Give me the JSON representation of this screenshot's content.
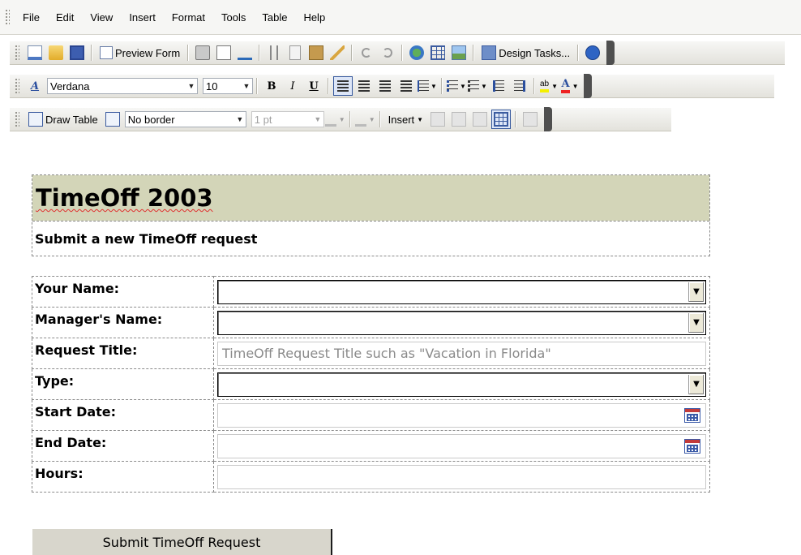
{
  "menubar": {
    "items": [
      "File",
      "Edit",
      "View",
      "Insert",
      "Format",
      "Tools",
      "Table",
      "Help"
    ]
  },
  "standard_toolbar": {
    "preview_form_label": "Preview Form",
    "design_tasks_label": "Design Tasks..."
  },
  "formatting_toolbar": {
    "font_name": "Verdana",
    "font_size": "10",
    "bold_label": "B",
    "italic_label": "I",
    "underline_label": "U",
    "highlight_label": "ab",
    "font_color_label": "A"
  },
  "table_toolbar": {
    "draw_table_label": "Draw Table",
    "border_style": "No border",
    "border_width": "1 pt",
    "insert_label": "Insert"
  },
  "form": {
    "title": "TimeOff 2003",
    "subtitle": "Submit a new TimeOff request",
    "fields": {
      "your_name_label": "Your Name:",
      "managers_name_label": "Manager's Name:",
      "request_title_label": "Request Title:",
      "request_title_placeholder": "TimeOff Request Title such as \"Vacation in Florida\"",
      "type_label": "Type:",
      "start_date_label": "Start Date:",
      "end_date_label": "End Date:",
      "hours_label": "Hours:"
    },
    "submit_label": "Submit TimeOff Request"
  },
  "colors": {
    "title_band": "#d3d5b8",
    "dashed_border": "#8b8b8b",
    "spell_underline": "#e03030"
  }
}
